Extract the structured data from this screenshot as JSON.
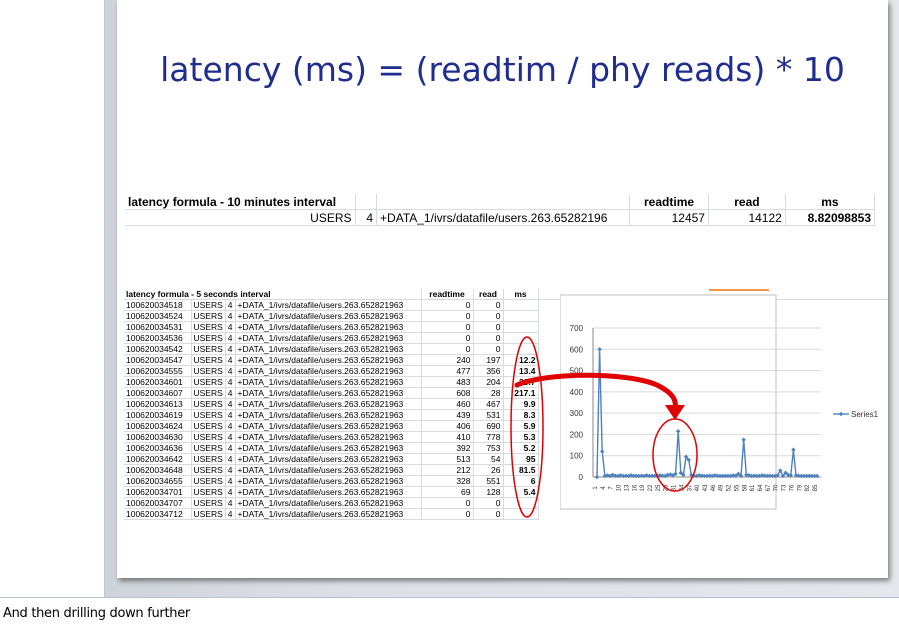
{
  "slide": {
    "title": "latency (ms) = (readtim / phy reads) * 10"
  },
  "table1": {
    "header": {
      "label": "latency formula - 10 minutes interval",
      "readtime": "readtime",
      "read": "read",
      "ms": "ms"
    },
    "row": {
      "user": "USERS",
      "num": "4",
      "file": "+DATA_1/ivrs/datafile/users.263.65282196",
      "readtime": "12457",
      "read": "14122",
      "ms": "8.82098853"
    }
  },
  "table2": {
    "header": {
      "label": "latency formula - 5 seconds interval",
      "readtime": "readtime",
      "read": "read",
      "ms": "ms"
    },
    "rows": [
      {
        "id": "100620034518",
        "user": "USERS",
        "num": "4",
        "file": "+DATA_1/ivrs/datafile/users.263.652821963",
        "readtime": "0",
        "read": "0",
        "ms": ""
      },
      {
        "id": "100620034524",
        "user": "USERS",
        "num": "4",
        "file": "+DATA_1/ivrs/datafile/users.263.652821963",
        "readtime": "0",
        "read": "0",
        "ms": ""
      },
      {
        "id": "100620034531",
        "user": "USERS",
        "num": "4",
        "file": "+DATA_1/ivrs/datafile/users.263.652821963",
        "readtime": "0",
        "read": "0",
        "ms": ""
      },
      {
        "id": "100620034536",
        "user": "USERS",
        "num": "4",
        "file": "+DATA_1/ivrs/datafile/users.263.652821963",
        "readtime": "0",
        "read": "0",
        "ms": ""
      },
      {
        "id": "100620034542",
        "user": "USERS",
        "num": "4",
        "file": "+DATA_1/ivrs/datafile/users.263.652821963",
        "readtime": "0",
        "read": "0",
        "ms": ""
      },
      {
        "id": "100620034547",
        "user": "USERS",
        "num": "4",
        "file": "+DATA_1/ivrs/datafile/users.263.652821963",
        "readtime": "240",
        "read": "197",
        "ms": "12.2"
      },
      {
        "id": "100620034555",
        "user": "USERS",
        "num": "4",
        "file": "+DATA_1/ivrs/datafile/users.263.652821963",
        "readtime": "477",
        "read": "356",
        "ms": "13.4"
      },
      {
        "id": "100620034601",
        "user": "USERS",
        "num": "4",
        "file": "+DATA_1/ivrs/datafile/users.263.652821963",
        "readtime": "483",
        "read": "204",
        "ms": "23.7"
      },
      {
        "id": "100620034607",
        "user": "USERS",
        "num": "4",
        "file": "+DATA_1/ivrs/datafile/users.263.652821963",
        "readtime": "608",
        "read": "28",
        "ms": "217.1"
      },
      {
        "id": "100620034613",
        "user": "USERS",
        "num": "4",
        "file": "+DATA_1/ivrs/datafile/users.263.652821963",
        "readtime": "460",
        "read": "467",
        "ms": "9.9"
      },
      {
        "id": "100620034619",
        "user": "USERS",
        "num": "4",
        "file": "+DATA_1/ivrs/datafile/users.263.652821963",
        "readtime": "439",
        "read": "531",
        "ms": "8.3"
      },
      {
        "id": "100620034624",
        "user": "USERS",
        "num": "4",
        "file": "+DATA_1/ivrs/datafile/users.263.652821963",
        "readtime": "406",
        "read": "690",
        "ms": "5.9"
      },
      {
        "id": "100620034630",
        "user": "USERS",
        "num": "4",
        "file": "+DATA_1/ivrs/datafile/users.263.652821963",
        "readtime": "410",
        "read": "778",
        "ms": "5.3"
      },
      {
        "id": "100620034636",
        "user": "USERS",
        "num": "4",
        "file": "+DATA_1/ivrs/datafile/users.263.652821963",
        "readtime": "392",
        "read": "753",
        "ms": "5.2"
      },
      {
        "id": "100620034642",
        "user": "USERS",
        "num": "4",
        "file": "+DATA_1/ivrs/datafile/users.263.652821963",
        "readtime": "513",
        "read": "54",
        "ms": "95"
      },
      {
        "id": "100620034648",
        "user": "USERS",
        "num": "4",
        "file": "+DATA_1/ivrs/datafile/users.263.652821963",
        "readtime": "212",
        "read": "26",
        "ms": "81.5"
      },
      {
        "id": "100620034655",
        "user": "USERS",
        "num": "4",
        "file": "+DATA_1/ivrs/datafile/users.263.652821963",
        "readtime": "328",
        "read": "551",
        "ms": "6"
      },
      {
        "id": "100620034701",
        "user": "USERS",
        "num": "4",
        "file": "+DATA_1/ivrs/datafile/users.263.652821963",
        "readtime": "69",
        "read": "128",
        "ms": "5.4"
      },
      {
        "id": "100620034707",
        "user": "USERS",
        "num": "4",
        "file": "+DATA_1/ivrs/datafile/users.263.652821963",
        "readtime": "0",
        "read": "0",
        "ms": ""
      },
      {
        "id": "100620034712",
        "user": "USERS",
        "num": "4",
        "file": "+DATA_1/ivrs/datafile/users.263.652821963",
        "readtime": "0",
        "read": "0",
        "ms": ""
      }
    ]
  },
  "chart_data": {
    "type": "line",
    "yticks": [
      "0",
      "100",
      "200",
      "300",
      "400",
      "500",
      "600",
      "700"
    ],
    "ylim": [
      0,
      700
    ],
    "legend": "Series1",
    "legend_position": "right",
    "grid": true,
    "x_tick_labels": [
      "1",
      "4",
      "7",
      "10",
      "13",
      "16",
      "19",
      "22",
      "25",
      "28",
      "31",
      "34",
      "37",
      "40",
      "43",
      "46",
      "49",
      "52",
      "55",
      "58",
      "61",
      "64",
      "67",
      "70",
      "73",
      "76",
      "79",
      "82",
      "85"
    ],
    "series": [
      {
        "name": "Series1",
        "values": [
          0,
          600,
          120,
          5,
          8,
          5,
          10,
          6,
          5,
          8,
          5,
          6,
          5,
          8,
          6,
          5,
          5,
          6,
          5,
          8,
          5,
          6,
          5,
          5,
          8,
          6,
          5,
          10,
          12,
          8,
          15,
          215,
          20,
          10,
          95,
          80,
          10,
          6,
          5,
          8,
          6,
          5,
          5,
          6,
          5,
          8,
          6,
          5,
          5,
          6,
          5,
          5,
          8,
          6,
          15,
          5,
          175,
          10,
          8,
          5,
          6,
          5,
          5,
          8,
          6,
          5,
          6,
          5,
          5,
          8,
          30,
          5,
          20,
          10,
          8,
          128,
          8,
          6,
          5,
          5,
          5,
          5,
          5,
          5,
          5
        ]
      }
    ]
  },
  "annotation_color": "#e00000",
  "notes": {
    "text": "And then drilling down further"
  }
}
